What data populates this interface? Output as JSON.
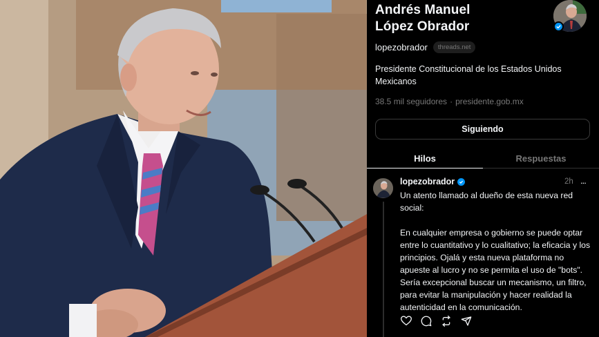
{
  "profile": {
    "name_line1": "Andrés Manuel",
    "name_line2": "López Obrador",
    "handle": "lopezobrador",
    "domain": "threads.net",
    "bio": "Presidente Constitucional de los Estados Unidos Mexicanos",
    "followers": "38.5 mil seguidores",
    "website": "presidente.gob.mx",
    "follow_button": "Siguiendo",
    "verified": true
  },
  "tabs": [
    {
      "label": "Hilos",
      "active": true
    },
    {
      "label": "Respuestas",
      "active": false
    }
  ],
  "post": {
    "author": "lopezobrador",
    "time": "2h",
    "more_label": "...",
    "paragraph1": "Un atento llamado al dueño de esta nueva red social:",
    "paragraph2": "En cualquier empresa o gobierno se puede optar entre lo cuantitativo y lo cualitativo; la eficacia y los principios. Ojalá y esta nueva plataforma no apueste al lucro y no se permita el uso de \"bots\". Sería excepcional buscar un mecanismo, un filtro, para evitar la manipulación y hacer realidad la autenticidad en la comunicación.",
    "actions": [
      "heart-icon",
      "comment-icon",
      "repost-icon",
      "share-icon"
    ]
  },
  "colors": {
    "background": "#000000",
    "text": "#f3f5f7",
    "muted": "#777777",
    "verified": "#0095f6"
  }
}
